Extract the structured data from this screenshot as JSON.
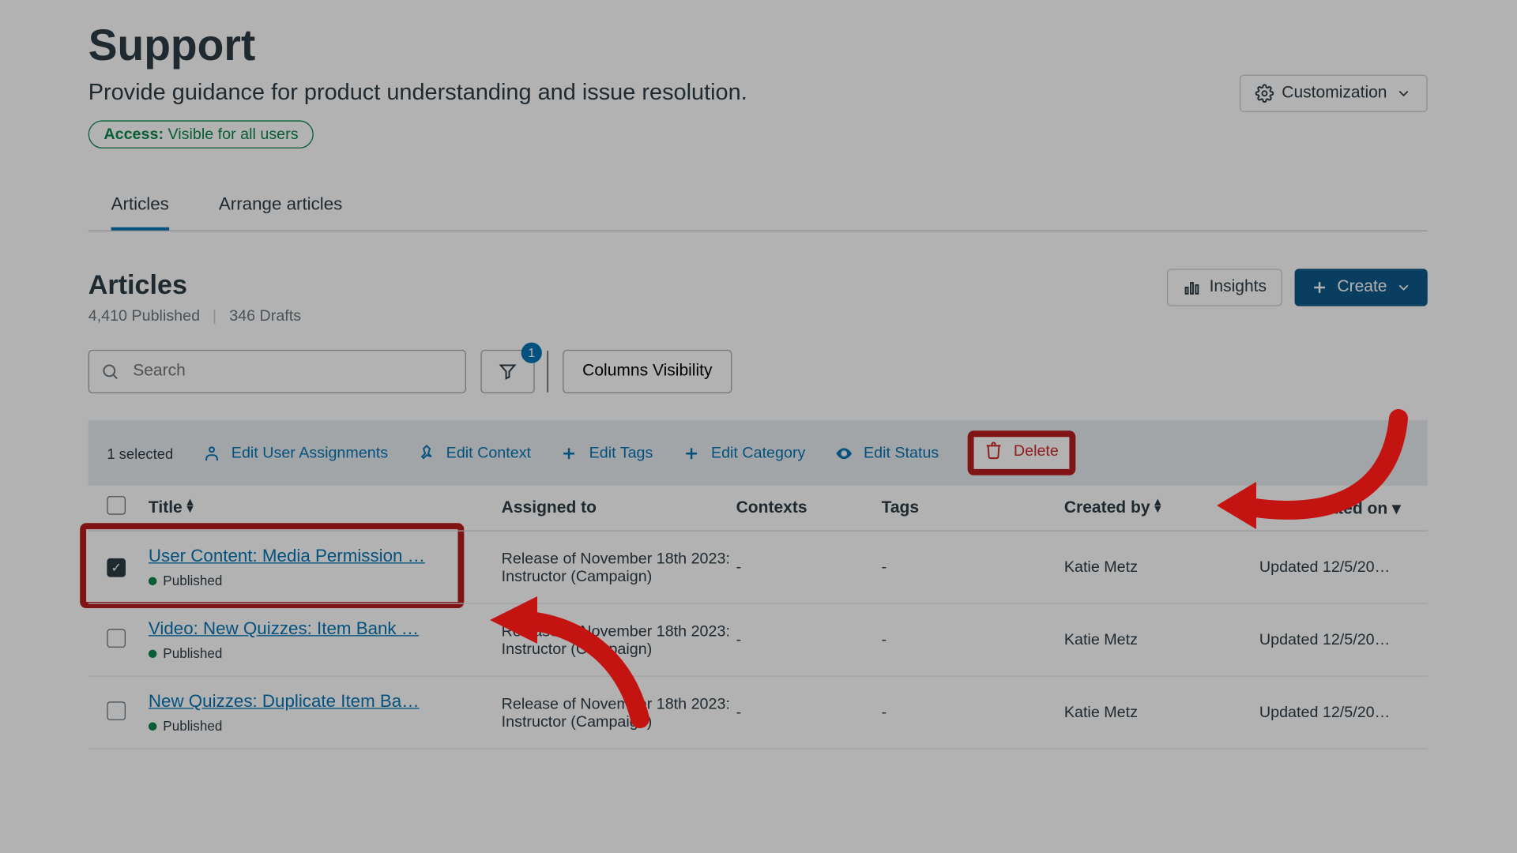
{
  "header": {
    "title": "Support",
    "subtitle": "Provide guidance for product understanding and issue resolution.",
    "access_label": "Access:",
    "access_value": "Visible for all users",
    "customization_label": "Customization"
  },
  "tabs": {
    "articles": "Articles",
    "arrange": "Arrange articles"
  },
  "section": {
    "title": "Articles",
    "published_count": "4,410 Published",
    "drafts_count": "346 Drafts",
    "insights_label": "Insights",
    "create_label": "Create"
  },
  "search": {
    "placeholder": "Search"
  },
  "filter": {
    "badge": "1"
  },
  "columns_visibility_label": "Columns Visibility",
  "bulk": {
    "selected": "1 selected",
    "edit_user": "Edit User Assignments",
    "edit_context": "Edit Context",
    "edit_tags": "Edit Tags",
    "edit_category": "Edit Category",
    "edit_status": "Edit Status",
    "delete": "Delete"
  },
  "columns": {
    "title": "Title",
    "assigned": "Assigned to",
    "contexts": "Contexts",
    "tags": "Tags",
    "created": "Created by",
    "updated": "Last updated on"
  },
  "rows": [
    {
      "checked": true,
      "title": "User Content: Media Permission …",
      "status": "Published",
      "assigned": "Release of November 18th 2023: Instructor (Campaign)",
      "contexts": "-",
      "tags": "-",
      "created": "Katie Metz",
      "updated": "Updated 12/5/20…"
    },
    {
      "checked": false,
      "title": "Video: New Quizzes: Item Bank …",
      "status": "Published",
      "assigned": "Release of November 18th 2023: Instructor (Campaign)",
      "contexts": "-",
      "tags": "-",
      "created": "Katie Metz",
      "updated": "Updated 12/5/20…"
    },
    {
      "checked": false,
      "title": "New Quizzes: Duplicate Item Ba…",
      "status": "Published",
      "assigned": "Release of November 18th 2023: Instructor (Campaign)",
      "contexts": "-",
      "tags": "-",
      "created": "Katie Metz",
      "updated": "Updated 12/5/20…"
    }
  ]
}
